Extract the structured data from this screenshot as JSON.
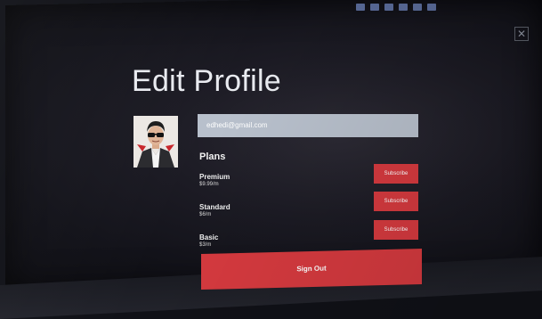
{
  "window": {
    "close_glyph": "✕"
  },
  "profile": {
    "title": "Edit Profile",
    "email": "edhedi@gmail.com"
  },
  "plans": {
    "heading": "Plans",
    "items": [
      {
        "name": "Premium",
        "price": "$9.99/m",
        "button_label": "Subscribe"
      },
      {
        "name": "Standard",
        "price": "$6/m",
        "button_label": "Subscribe"
      },
      {
        "name": "Basic",
        "price": "$3/m",
        "button_label": "Subscribe"
      }
    ]
  },
  "actions": {
    "sign_out": "Sign Out"
  },
  "colors": {
    "accent_red": "#d63a3f",
    "email_field_bg": "#b8c0cc",
    "background": "#1c1b24"
  }
}
